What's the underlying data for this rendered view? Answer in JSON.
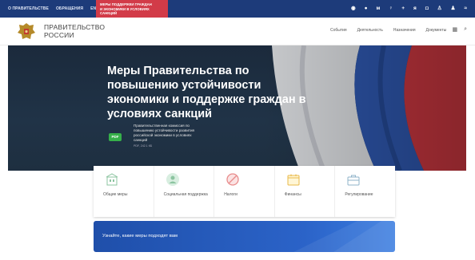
{
  "topbar": {
    "links": [
      "О ПРАВИТЕЛЬСТВЕ",
      "ОБРАЩЕНИЯ",
      "ENG"
    ],
    "alert_lines": [
      "МЕРЫ ПОДДЕРЖКИ ГРАЖДАН",
      "И ЭКОНОМИКИ В УСЛОВИЯХ САНКЦИЙ"
    ]
  },
  "header": {
    "logo_lines": [
      "ПРАВИТЕЛЬСТВО",
      "РОССИИ"
    ],
    "nav": [
      "События",
      "Деятельность",
      "Назначения",
      "Документы"
    ]
  },
  "hero": {
    "title": "Меры Правительства по повышению устойчивости экономики и поддержке граждан в условиях санкций",
    "pdf_label": "PDF",
    "doc_text": "Правительственная комиссия по повышению устойчивости развития российской экономики в условиях санкций",
    "doc_size": "PDF, 242.1 КБ"
  },
  "cards": [
    {
      "label": "Общие меры",
      "icon": "building-icon"
    },
    {
      "label": "Социальная поддержка",
      "icon": "person-icon"
    },
    {
      "label": "Налоги",
      "icon": "no-sign-icon"
    },
    {
      "label": "Финансы",
      "icon": "calendar-icon"
    },
    {
      "label": "Регулирование",
      "icon": "briefcase-icon"
    }
  ],
  "banner": {
    "text": "Узнайте, какие меры подходят вам"
  },
  "colors": {
    "topbar": "#1d3b7a",
    "alert": "#d23b48",
    "pdf": "#36b04a",
    "banner": "#2b63c8",
    "card_icon": "#8cc4a0"
  }
}
